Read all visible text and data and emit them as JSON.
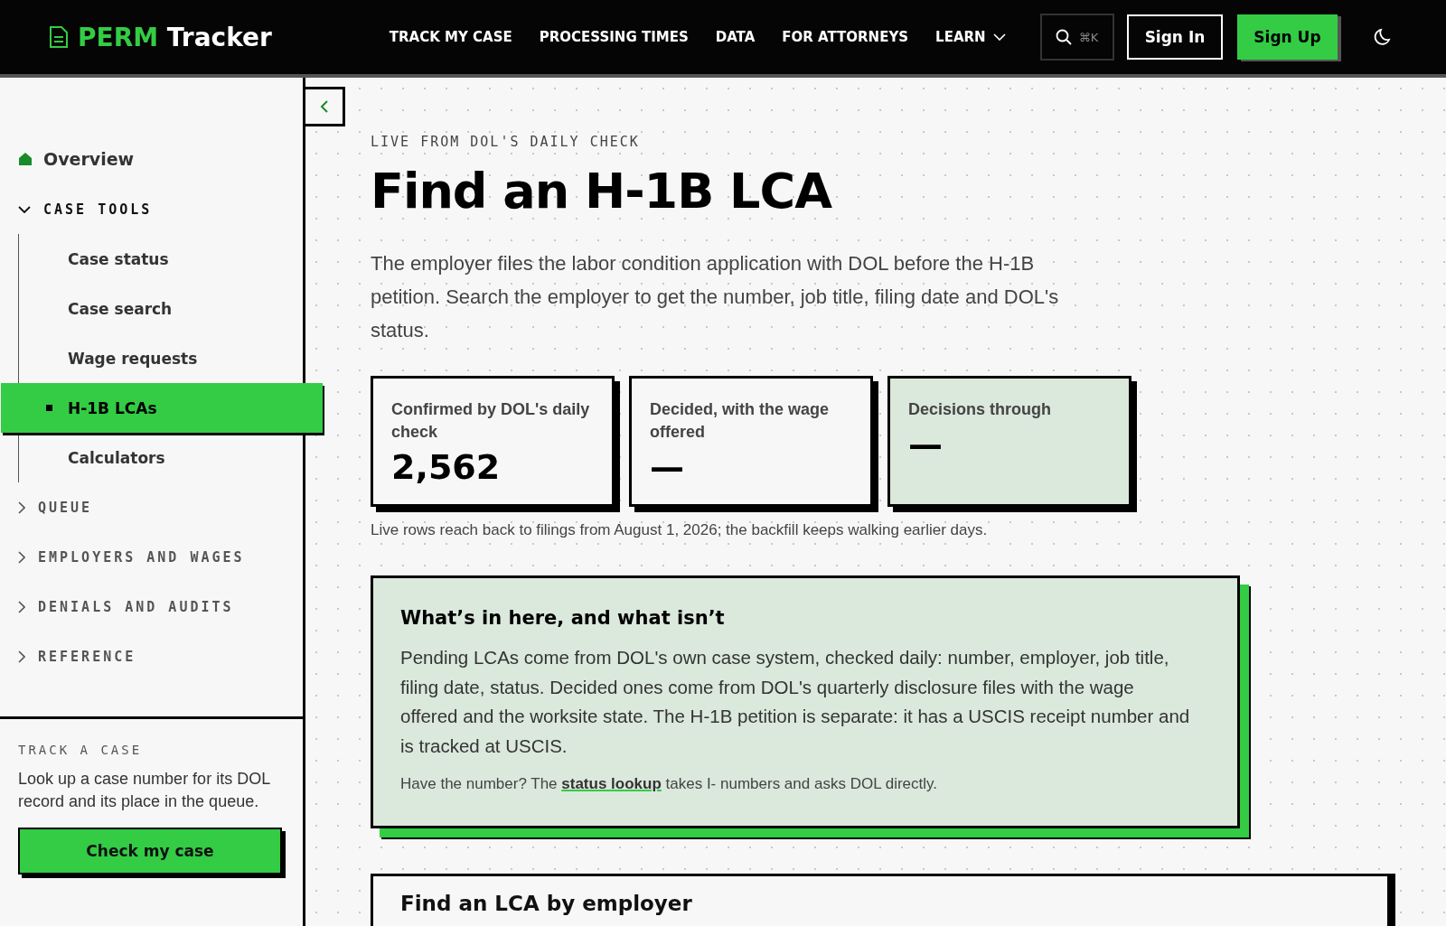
{
  "header": {
    "logo": {
      "prefix": "PERM",
      "suffix": "Tracker"
    },
    "nav": [
      {
        "label": "TRACK MY CASE",
        "has_dropdown": false
      },
      {
        "label": "PROCESSING TIMES",
        "has_dropdown": false
      },
      {
        "label": "DATA",
        "has_dropdown": false
      },
      {
        "label": "FOR ATTORNEYS",
        "has_dropdown": false
      },
      {
        "label": "LEARN",
        "has_dropdown": true
      }
    ],
    "search": {
      "shortcut": "⌘K"
    },
    "sign_in": "Sign In",
    "sign_up": "Sign Up"
  },
  "sidebar": {
    "overview": {
      "label": "Overview",
      "selected": false
    },
    "groups": [
      {
        "label": "CASE TOOLS",
        "expanded": true,
        "children": [
          {
            "label": "Case status",
            "selected": false
          },
          {
            "label": "Case search",
            "selected": false
          },
          {
            "label": "Wage requests",
            "selected": false
          },
          {
            "label": "H-1B LCAs",
            "selected": true
          },
          {
            "label": "Calculators",
            "selected": false
          }
        ]
      },
      {
        "label": "QUEUE",
        "expanded": false
      },
      {
        "label": "EMPLOYERS AND WAGES",
        "expanded": false
      },
      {
        "label": "DENIALS AND AUDITS",
        "expanded": false
      },
      {
        "label": "REFERENCE",
        "expanded": false
      }
    ],
    "cta": {
      "eyebrow": "TRACK A CASE",
      "text": "Look up a case number for its DOL record and its place in the queue.",
      "button": "Check my case"
    }
  },
  "main": {
    "eyebrow": "LIVE FROM DOL'S DAILY CHECK",
    "title": "Find an H-1B LCA",
    "intro": "The employer files the labor condition application with DOL before the H-1B petition. Search the employer to get the number, job title, filing date and DOL's status.",
    "stats": [
      {
        "label": "Confirmed by DOL's daily check",
        "value": "2,562",
        "highlighted": false
      },
      {
        "label": "Decided, with the wage offered",
        "value": "—",
        "highlighted": false
      },
      {
        "label": "Decisions through",
        "value": "—",
        "highlighted": true
      }
    ],
    "note": "Live rows reach back to filings from August 1, 2026; the backfill keeps walking earlier days.",
    "info": {
      "title": "What’s in here, and what isn’t",
      "body": "Pending LCAs come from DOL's own case system, checked daily: number, employer, job title, filing date, status. Decided ones come from DOL's quarterly disclosure files with the wage offered and the worksite state. The H-1B petition is separate: it has a USCIS receipt number and is tracked at USCIS.",
      "footer_before": "Have the number? The",
      "link": "status lookup",
      "footer_after": "takes I- numbers and asks DOL directly."
    },
    "section_title": "Find an LCA by employer"
  }
}
